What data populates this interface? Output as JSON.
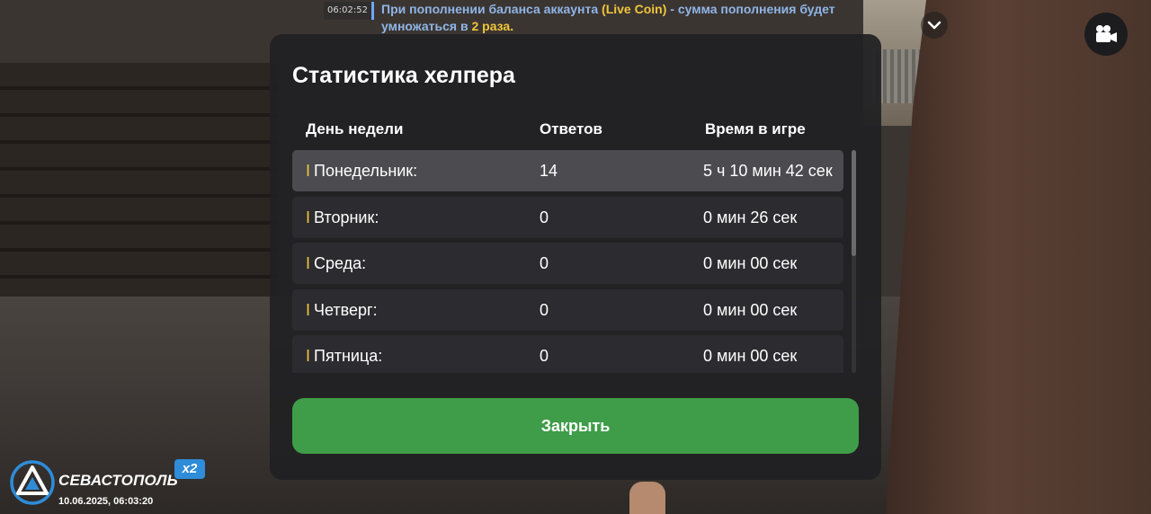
{
  "chat": {
    "time": "06:02:52",
    "line1_plain": "При пополнении баланса аккаунта ",
    "line1_highlight": "(Live Coin)",
    "line1_rest": " - сумма пополнения будет",
    "line2_plain": "умножаться в ",
    "line2_highlight": "2 раза."
  },
  "dialog": {
    "title": "Статистика хелпера",
    "columns": {
      "day": "День недели",
      "answers": "Ответов",
      "time": "Время в игре"
    },
    "rows": [
      {
        "day": "Понедельник:",
        "answers": "14",
        "time": "5 ч 10 мин 42 сек",
        "active": true
      },
      {
        "day": "Вторник:",
        "answers": "0",
        "time": "0 мин 26 сек",
        "active": false
      },
      {
        "day": "Среда:",
        "answers": "0",
        "time": "0 мин 00 сек",
        "active": false
      },
      {
        "day": "Четверг:",
        "answers": "0",
        "time": "0 мин 00 сек",
        "active": false
      },
      {
        "day": "Пятница:",
        "answers": "0",
        "time": "0 мин 00 сек",
        "active": false
      }
    ],
    "row_marker": "I",
    "close_label": "Закрыть"
  },
  "logo": {
    "name": "СЕВАСТОПОЛЬ",
    "badge": "x2",
    "datetime": "10.06.2025, 06:03:20"
  },
  "icons": {
    "collapse": "chevron-down-icon",
    "camera": "video-camera-icon",
    "logo": "server-logo-icon"
  },
  "colors": {
    "accent_green": "#3f9d49",
    "marker_yellow": "#f0c63a",
    "chat_blue": "#8fb5e6",
    "badge_blue": "#2e8cd8"
  }
}
